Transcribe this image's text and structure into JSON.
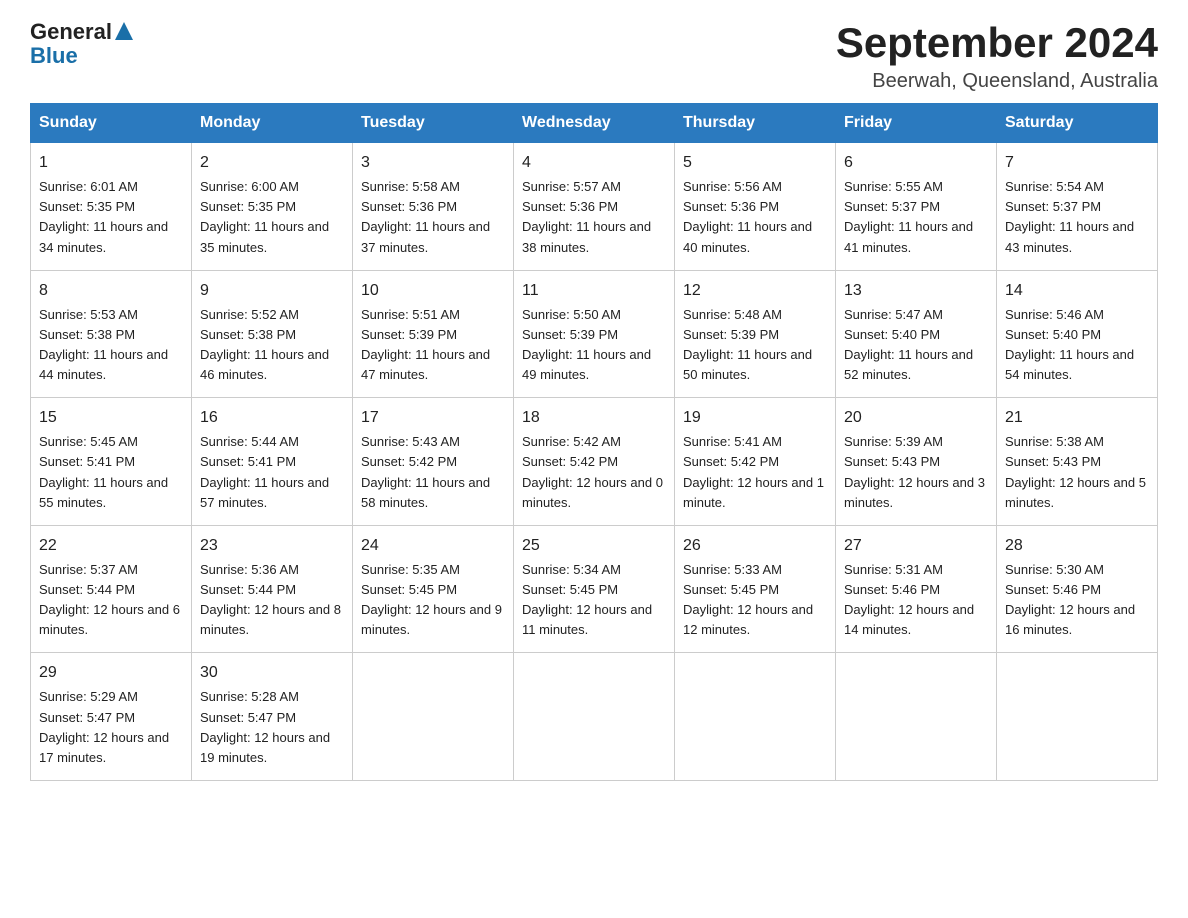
{
  "header": {
    "logo_general": "General",
    "logo_blue": "Blue",
    "title": "September 2024",
    "subtitle": "Beerwah, Queensland, Australia"
  },
  "days_of_week": [
    "Sunday",
    "Monday",
    "Tuesday",
    "Wednesday",
    "Thursday",
    "Friday",
    "Saturday"
  ],
  "weeks": [
    [
      {
        "day": "1",
        "sunrise": "6:01 AM",
        "sunset": "5:35 PM",
        "daylight": "11 hours and 34 minutes."
      },
      {
        "day": "2",
        "sunrise": "6:00 AM",
        "sunset": "5:35 PM",
        "daylight": "11 hours and 35 minutes."
      },
      {
        "day": "3",
        "sunrise": "5:58 AM",
        "sunset": "5:36 PM",
        "daylight": "11 hours and 37 minutes."
      },
      {
        "day": "4",
        "sunrise": "5:57 AM",
        "sunset": "5:36 PM",
        "daylight": "11 hours and 38 minutes."
      },
      {
        "day": "5",
        "sunrise": "5:56 AM",
        "sunset": "5:36 PM",
        "daylight": "11 hours and 40 minutes."
      },
      {
        "day": "6",
        "sunrise": "5:55 AM",
        "sunset": "5:37 PM",
        "daylight": "11 hours and 41 minutes."
      },
      {
        "day": "7",
        "sunrise": "5:54 AM",
        "sunset": "5:37 PM",
        "daylight": "11 hours and 43 minutes."
      }
    ],
    [
      {
        "day": "8",
        "sunrise": "5:53 AM",
        "sunset": "5:38 PM",
        "daylight": "11 hours and 44 minutes."
      },
      {
        "day": "9",
        "sunrise": "5:52 AM",
        "sunset": "5:38 PM",
        "daylight": "11 hours and 46 minutes."
      },
      {
        "day": "10",
        "sunrise": "5:51 AM",
        "sunset": "5:39 PM",
        "daylight": "11 hours and 47 minutes."
      },
      {
        "day": "11",
        "sunrise": "5:50 AM",
        "sunset": "5:39 PM",
        "daylight": "11 hours and 49 minutes."
      },
      {
        "day": "12",
        "sunrise": "5:48 AM",
        "sunset": "5:39 PM",
        "daylight": "11 hours and 50 minutes."
      },
      {
        "day": "13",
        "sunrise": "5:47 AM",
        "sunset": "5:40 PM",
        "daylight": "11 hours and 52 minutes."
      },
      {
        "day": "14",
        "sunrise": "5:46 AM",
        "sunset": "5:40 PM",
        "daylight": "11 hours and 54 minutes."
      }
    ],
    [
      {
        "day": "15",
        "sunrise": "5:45 AM",
        "sunset": "5:41 PM",
        "daylight": "11 hours and 55 minutes."
      },
      {
        "day": "16",
        "sunrise": "5:44 AM",
        "sunset": "5:41 PM",
        "daylight": "11 hours and 57 minutes."
      },
      {
        "day": "17",
        "sunrise": "5:43 AM",
        "sunset": "5:42 PM",
        "daylight": "11 hours and 58 minutes."
      },
      {
        "day": "18",
        "sunrise": "5:42 AM",
        "sunset": "5:42 PM",
        "daylight": "12 hours and 0 minutes."
      },
      {
        "day": "19",
        "sunrise": "5:41 AM",
        "sunset": "5:42 PM",
        "daylight": "12 hours and 1 minute."
      },
      {
        "day": "20",
        "sunrise": "5:39 AM",
        "sunset": "5:43 PM",
        "daylight": "12 hours and 3 minutes."
      },
      {
        "day": "21",
        "sunrise": "5:38 AM",
        "sunset": "5:43 PM",
        "daylight": "12 hours and 5 minutes."
      }
    ],
    [
      {
        "day": "22",
        "sunrise": "5:37 AM",
        "sunset": "5:44 PM",
        "daylight": "12 hours and 6 minutes."
      },
      {
        "day": "23",
        "sunrise": "5:36 AM",
        "sunset": "5:44 PM",
        "daylight": "12 hours and 8 minutes."
      },
      {
        "day": "24",
        "sunrise": "5:35 AM",
        "sunset": "5:45 PM",
        "daylight": "12 hours and 9 minutes."
      },
      {
        "day": "25",
        "sunrise": "5:34 AM",
        "sunset": "5:45 PM",
        "daylight": "12 hours and 11 minutes."
      },
      {
        "day": "26",
        "sunrise": "5:33 AM",
        "sunset": "5:45 PM",
        "daylight": "12 hours and 12 minutes."
      },
      {
        "day": "27",
        "sunrise": "5:31 AM",
        "sunset": "5:46 PM",
        "daylight": "12 hours and 14 minutes."
      },
      {
        "day": "28",
        "sunrise": "5:30 AM",
        "sunset": "5:46 PM",
        "daylight": "12 hours and 16 minutes."
      }
    ],
    [
      {
        "day": "29",
        "sunrise": "5:29 AM",
        "sunset": "5:47 PM",
        "daylight": "12 hours and 17 minutes."
      },
      {
        "day": "30",
        "sunrise": "5:28 AM",
        "sunset": "5:47 PM",
        "daylight": "12 hours and 19 minutes."
      },
      null,
      null,
      null,
      null,
      null
    ]
  ],
  "labels": {
    "sunrise": "Sunrise:",
    "sunset": "Sunset:",
    "daylight": "Daylight:"
  }
}
